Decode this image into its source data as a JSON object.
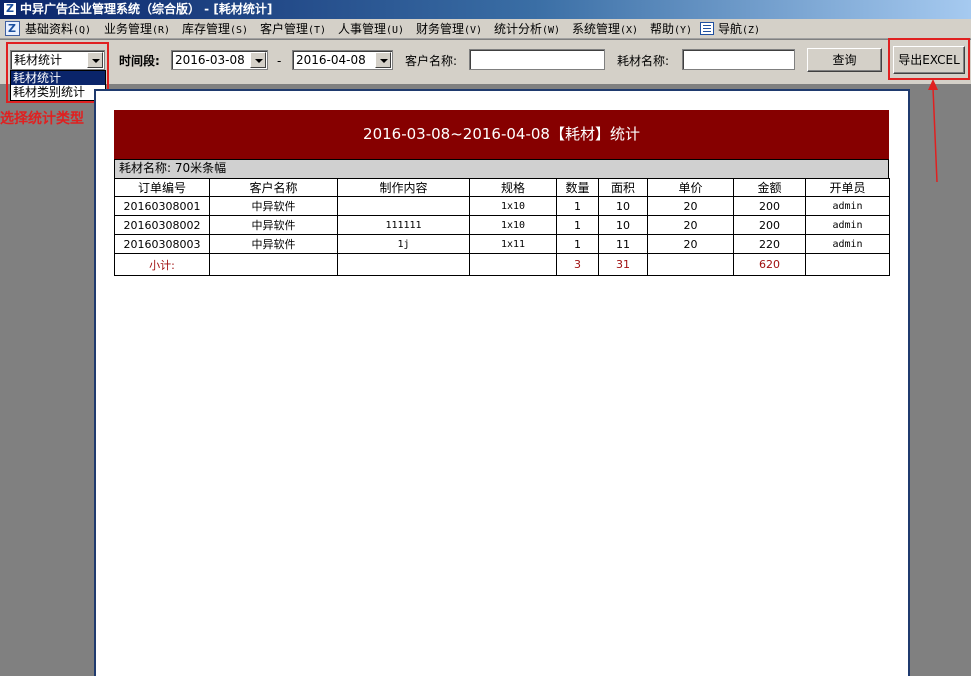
{
  "window": {
    "title": "中异广告企业管理系统（综合版） - [耗材统计]"
  },
  "menubar": {
    "items": [
      {
        "label": "基础资料",
        "key": "(Q)"
      },
      {
        "label": "业务管理",
        "key": "(R)"
      },
      {
        "label": "库存管理",
        "key": "(S)"
      },
      {
        "label": "客户管理",
        "key": "(T)"
      },
      {
        "label": "人事管理",
        "key": "(U)"
      },
      {
        "label": "财务管理",
        "key": "(V)"
      },
      {
        "label": "统计分析",
        "key": "(W)"
      },
      {
        "label": "系统管理",
        "key": "(X)"
      },
      {
        "label": "帮助",
        "key": "(Y)"
      },
      {
        "label": "导航",
        "key": "(Z)"
      }
    ]
  },
  "toolbar": {
    "stat_type": {
      "value": "耗材统计",
      "options": [
        "耗材统计",
        "耗材类别统计"
      ]
    },
    "period_label": "时间段:",
    "date_from": "2016-03-08",
    "date_separator": "-",
    "date_to": "2016-04-08",
    "customer_label": "客户名称:",
    "customer_value": "",
    "material_label": "耗材名称:",
    "material_value": "",
    "query_label": "查询",
    "export_label": "导出EXCEL"
  },
  "annotation": {
    "text": "选择统计类型",
    "color": "#e02020"
  },
  "report": {
    "title": "2016-03-08~2016-04-08【耗材】统计",
    "header_color": "#860000",
    "material_line": "耗材名称: 70米条幅",
    "columns": [
      "订单编号",
      "客户名称",
      "制作内容",
      "规格",
      "数量",
      "面积",
      "单价",
      "金额",
      "开单员"
    ],
    "rows": [
      [
        "20160308001",
        "中异软件",
        "",
        "1x10",
        "1",
        "10",
        "20",
        "200",
        "admin"
      ],
      [
        "20160308002",
        "中异软件",
        "111111",
        "1x10",
        "1",
        "10",
        "20",
        "200",
        "admin"
      ],
      [
        "20160308003",
        "中异软件",
        "1j",
        "1x11",
        "1",
        "11",
        "20",
        "220",
        "admin"
      ]
    ],
    "subtotal": {
      "label": "小计:",
      "quantity": "3",
      "area": "31",
      "amount": "620"
    }
  }
}
